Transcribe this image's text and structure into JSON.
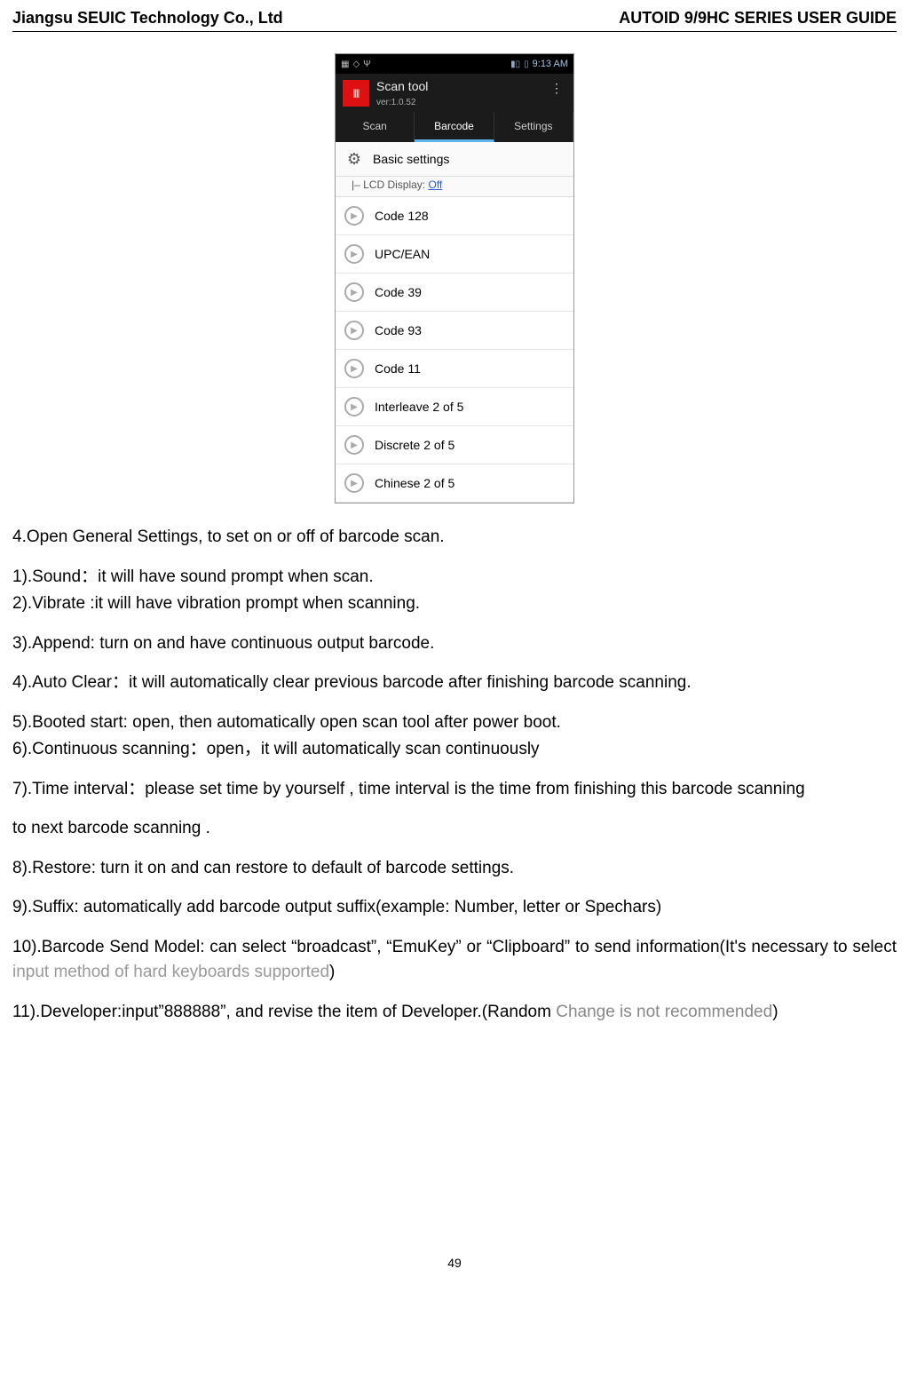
{
  "header": {
    "left": "Jiangsu SEUIC Technology Co., Ltd",
    "right": "AUTOID 9/9HC SERIES USER GUIDE"
  },
  "phone": {
    "statusbar": {
      "time": "9:13 AM",
      "signal": "▮▯",
      "battery": "▯"
    },
    "app": {
      "title": "Scan tool",
      "version": "ver:1.0.52"
    },
    "tabs": {
      "t1": "Scan",
      "t2": "Barcode",
      "t3": "Settings",
      "active": "t2"
    },
    "basic": "Basic settings",
    "lcd": {
      "prefix": "|– LCD Display: ",
      "value": "Off"
    },
    "rows": [
      "Code 128",
      "UPC/EAN",
      "Code 39",
      "Code 93",
      "Code 11",
      "Interleave 2 of 5",
      "Discrete 2 of 5",
      "Chinese 2 of 5"
    ]
  },
  "body": {
    "p1": "4.Open General Settings, to set on or off of barcode scan.",
    "p2": "1).Sound：it will have sound prompt when scan.",
    "p2b": "2).Vibrate :it will have vibration prompt when scanning.",
    "p3": "3).Append: turn on and have continuous output barcode.",
    "p4": "4).Auto Clear：it will automatically clear previous barcode after finishing barcode scanning.",
    "p5": "5).Booted start: open, then automatically open scan tool after power boot.",
    "p6": "6).Continuous scanning：open，it will automatically scan continuously",
    "p7a": "7).Time interval：please set time by yourself , time interval is the time from finishing this barcode scanning",
    "p7b": "to next barcode scanning .",
    "p8": "8).Restore: turn it on and can restore to default of barcode settings.",
    "p9": "9).Suffix: automatically add barcode output suffix(example: Number, letter or Spechars)",
    "p10a": "10).Barcode  Send  Model:  can  select  “broadcast”,  “EmuKey”  or  “Clipboard”  to  send  information(It's necessary  to  select ",
    "p10gray": "input  method  of   hard  keyboards  supported",
    "p10end": ")",
    "p11a": "11).Developer:input”888888”, and revise the item of Developer.(Random ",
    "p11gray": "Change is not recommended",
    "p11end": ")"
  },
  "page_number": "49"
}
